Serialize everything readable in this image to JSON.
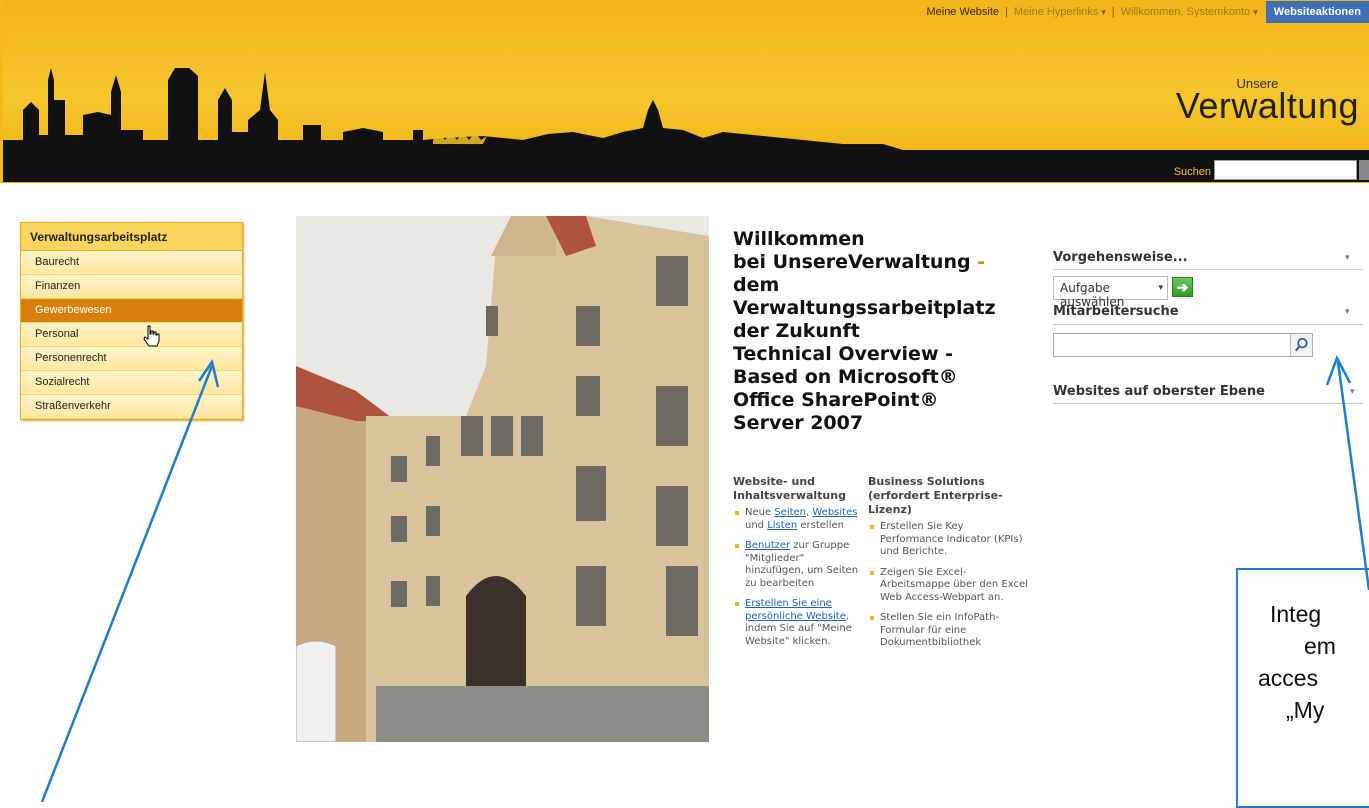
{
  "topnav": {
    "my_website": "Meine Website",
    "sep": "|",
    "my_links": "Meine Hyperlinks",
    "welcome": "Willkommen, Systemkonto",
    "actions": "Websiteaktionen"
  },
  "brand": {
    "small": "Unsere",
    "big": "Verwaltung"
  },
  "search": {
    "label": "Suchen",
    "placeholder": ""
  },
  "leftnav": {
    "heading": "Verwaltungsarbeitsplatz",
    "items": [
      {
        "label": "Baurecht"
      },
      {
        "label": "Finanzen"
      },
      {
        "label": "Gewerbewesen",
        "active": true
      },
      {
        "label": "Personal"
      },
      {
        "label": "Personenrecht"
      },
      {
        "label": "Sozialrecht"
      },
      {
        "label": "Straßenverkehr"
      }
    ]
  },
  "welcome": {
    "l1": "Willkommen",
    "l2a": "bei UnsereVerwaltung",
    "l2b": " -",
    "l3": "dem",
    "l4": "Verwaltungssarbeitplatz",
    "l5": "der Zukunft",
    "l6": "Technical Overview -",
    "l7": "Based on Microsoft®",
    "l8": "Office SharePoint®",
    "l9": "Server 2007"
  },
  "col1": {
    "heading": "Website- und Inhaltsverwaltung",
    "b1": {
      "a": "Neue ",
      "link1": "Seiten",
      "b": ", ",
      "link2": "Websites",
      "c": " und ",
      "link3": "Listen",
      "d": " erstellen"
    },
    "b2": {
      "link": "Benutzer",
      "rest": " zur Gruppe \"Mitglieder\" hinzufügen, um Seiten zu bearbeiten"
    },
    "b3": {
      "link": "Erstellen Sie eine persönliche Website",
      "rest": ", indem Sie auf \"Meine Website\" klicken."
    }
  },
  "col2": {
    "heading": "Business Solutions (erfordert Enterprise-Lizenz)",
    "b1": "Erstellen Sie Key Performance Indicator (KPIs) und Berichte.",
    "b2": "Zeigen Sie Excel-Arbeitsmappe über den Excel Web Access-Webpart an.",
    "b3": "Stellen Sie ein InfoPath-Formular für eine Dokumentbibliothek"
  },
  "right": {
    "howto_title": "Vorgehensweise...",
    "task_select": "Aufgabe auswählen",
    "employee_title": "Mitarbeitersuche",
    "employee_value": "",
    "sites_title": "Websites auf oberster Ebene"
  },
  "callout": {
    "l1": "Integ",
    "l2": "em",
    "l3": "acces",
    "l4": "„My"
  },
  "colors": {
    "header_yellow": "#f6c52c",
    "nav_active": "#d77f0a",
    "accent_orange": "#e48a00",
    "link_blue": "#1e63b6",
    "annotation_blue": "#1f7ccf",
    "actions_blue": "#3f6fb5"
  }
}
